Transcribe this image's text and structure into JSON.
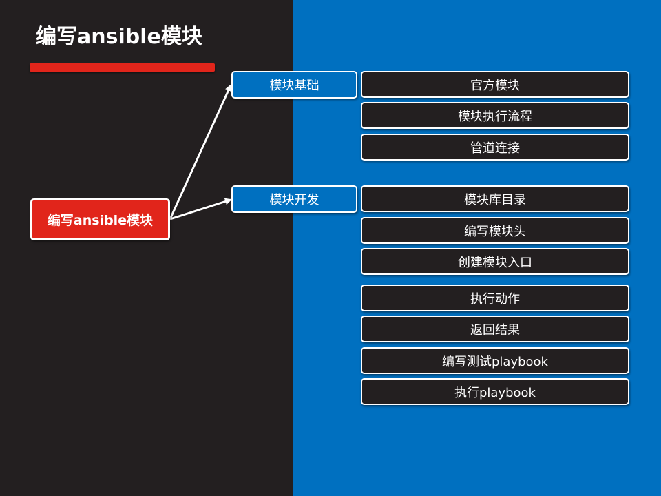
{
  "title": "编写ansible模块",
  "root": {
    "label": "编写ansible模块"
  },
  "categories": [
    {
      "label": "模块基础",
      "items": [
        "官方模块",
        "模块执行流程",
        "管道连接"
      ]
    },
    {
      "label": "模块开发",
      "items": [
        "模块库目录",
        "编写模块头",
        "创建模块入口",
        "执行动作",
        "返回结果",
        "编写测试playbook",
        "执行playbook"
      ]
    }
  ],
  "colors": {
    "dark": "#231f20",
    "blue": "#0070c0",
    "red": "#e1251b",
    "white": "#ffffff"
  }
}
